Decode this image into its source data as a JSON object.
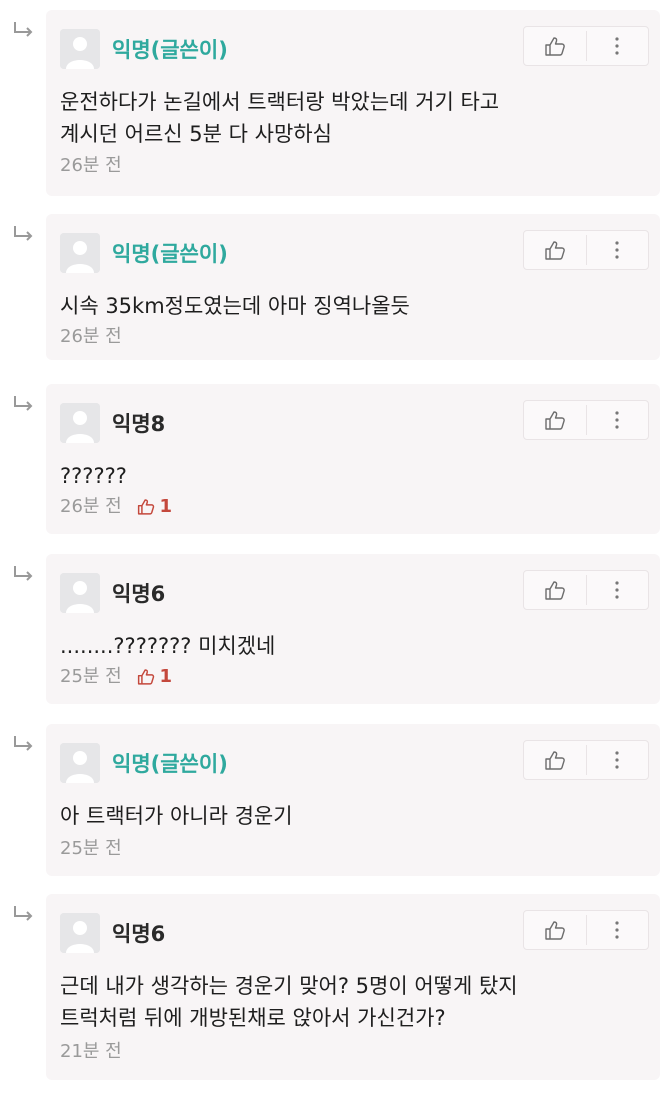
{
  "comments": [
    {
      "nickname": "익명(글쓴이)",
      "lines": [
        "운전하다가 논길에서 트랙터랑 박았는데 거기 타고",
        "계시던 어르신 5분 다 사망하심"
      ],
      "time": "26분 전",
      "likes": null
    },
    {
      "nickname": "익명(글쓴이)",
      "lines": [
        "시속 35km정도였는데 아마 징역나올듯"
      ],
      "time": "26분 전",
      "likes": null
    },
    {
      "nickname": "익명8",
      "lines": [
        "??????"
      ],
      "time": "26분 전",
      "likes": "1"
    },
    {
      "nickname": "익명6",
      "lines": [
        "........??????? 미치겠네"
      ],
      "time": "25분 전",
      "likes": "1"
    },
    {
      "nickname": "익명(글쓴이)",
      "lines": [
        "아 트랙터가 아니라 경운기"
      ],
      "time": "25분 전",
      "likes": null
    },
    {
      "nickname": "익명6",
      "lines": [
        "근데 내가 생각하는 경운기 맞어? 5명이 어떻게 탔지",
        "트럭처럼 뒤에 개방된채로 앉아서 가신건가?"
      ],
      "time": "21분 전",
      "likes": null
    }
  ],
  "icons": {
    "reply": "reply-arrow-icon",
    "avatar": "default-avatar-icon",
    "like": "thumbs-up-icon",
    "more": "vertical-dots-icon"
  },
  "colors": {
    "author_nick": "#2fa99e",
    "like_count": "#c4483c"
  }
}
